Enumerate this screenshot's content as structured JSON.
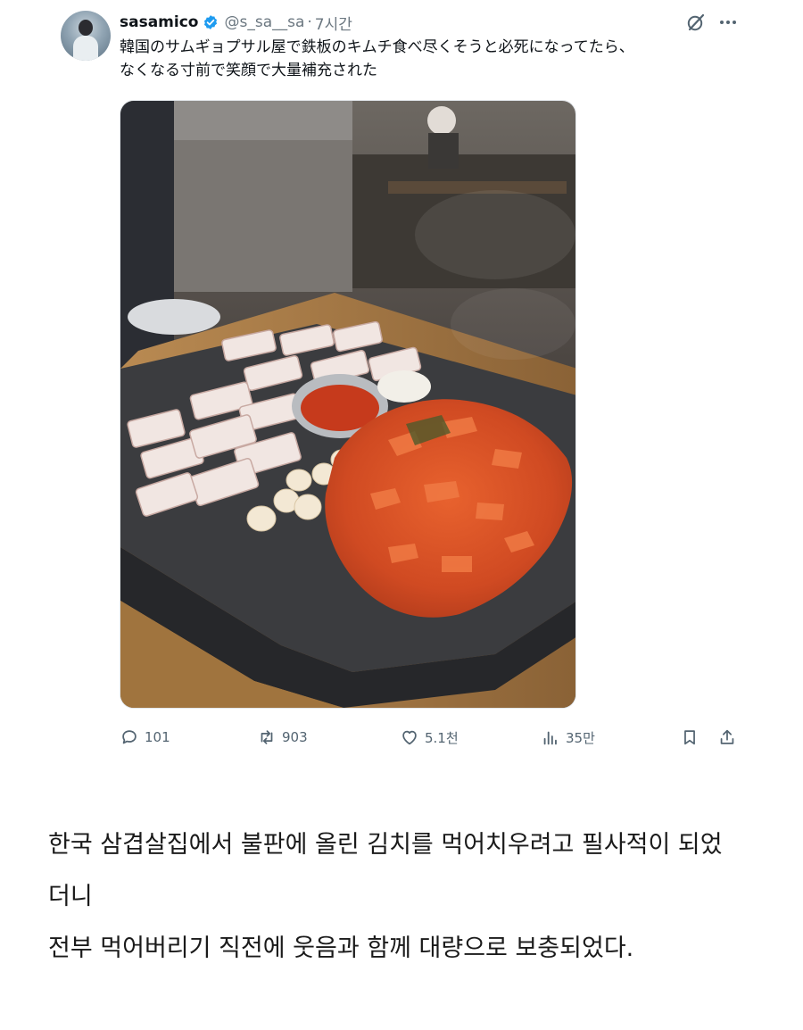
{
  "tweet": {
    "author_name": "sasamico",
    "handle": "@s_sa__sa",
    "separator": "·",
    "time": "7시간",
    "text_line1": "韓国のサムギョプサル屋で鉄板のキムチ食べ尽くそうと必死になってたら、",
    "text_line2": "なくなる寸前で笑顔で大量補充された",
    "icons": {
      "verified": "verified-badge-icon",
      "grok": "grok-icon",
      "more": "more-icon"
    },
    "accent_color": "#1d9bf0"
  },
  "actions": {
    "replies": "101",
    "retweets": "903",
    "likes": "5.1천",
    "views": "35만",
    "icons": [
      "reply-icon",
      "retweet-icon",
      "like-icon",
      "views-icon",
      "bookmark-icon",
      "share-icon"
    ]
  },
  "caption": {
    "line1": "한국 삼겹살집에서 불판에 올린 김치를 먹어치우려고 필사적이 되었",
    "line2": "더니",
    "line3": "전부 먹어버리기 직전에 웃음과 함께 대량으로 보충되었다."
  }
}
